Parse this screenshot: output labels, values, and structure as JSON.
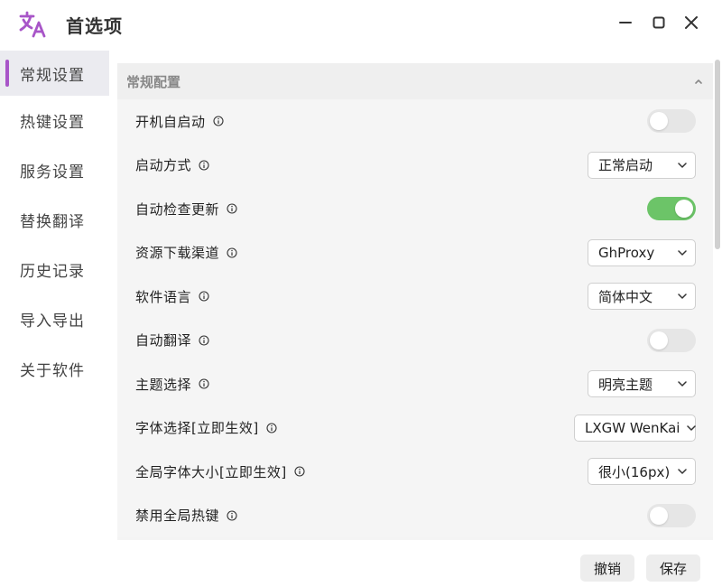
{
  "window": {
    "title": "首选项"
  },
  "sidebar": {
    "items": [
      {
        "label": "常规设置",
        "active": true
      },
      {
        "label": "热键设置"
      },
      {
        "label": "服务设置"
      },
      {
        "label": "替换翻译"
      },
      {
        "label": "历史记录"
      },
      {
        "label": "导入导出"
      },
      {
        "label": "关于软件"
      }
    ]
  },
  "section": {
    "title": "常规配置"
  },
  "settings": [
    {
      "label": "开机自启动",
      "type": "toggle",
      "on": false
    },
    {
      "label": "启动方式",
      "type": "select",
      "value": "正常启动"
    },
    {
      "label": "自动检查更新",
      "type": "toggle",
      "on": true
    },
    {
      "label": "资源下载渠道",
      "type": "select",
      "value": "GhProxy"
    },
    {
      "label": "软件语言",
      "type": "select",
      "value": "简体中文"
    },
    {
      "label": "自动翻译",
      "type": "toggle",
      "on": false
    },
    {
      "label": "主题选择",
      "type": "select",
      "value": "明亮主题"
    },
    {
      "label": "字体选择[立即生效]",
      "type": "select",
      "value": "LXGW WenKai"
    },
    {
      "label": "全局字体大小[立即生效]",
      "type": "select",
      "value": "很小(16px)"
    },
    {
      "label": "禁用全局热键",
      "type": "toggle",
      "on": false
    }
  ],
  "footer": {
    "cancel_label": "撤销",
    "save_label": "保存"
  },
  "colors": {
    "accent": "#a855c8",
    "toggle_on": "#6cc468",
    "toggle_off": "#e6e6e6"
  }
}
